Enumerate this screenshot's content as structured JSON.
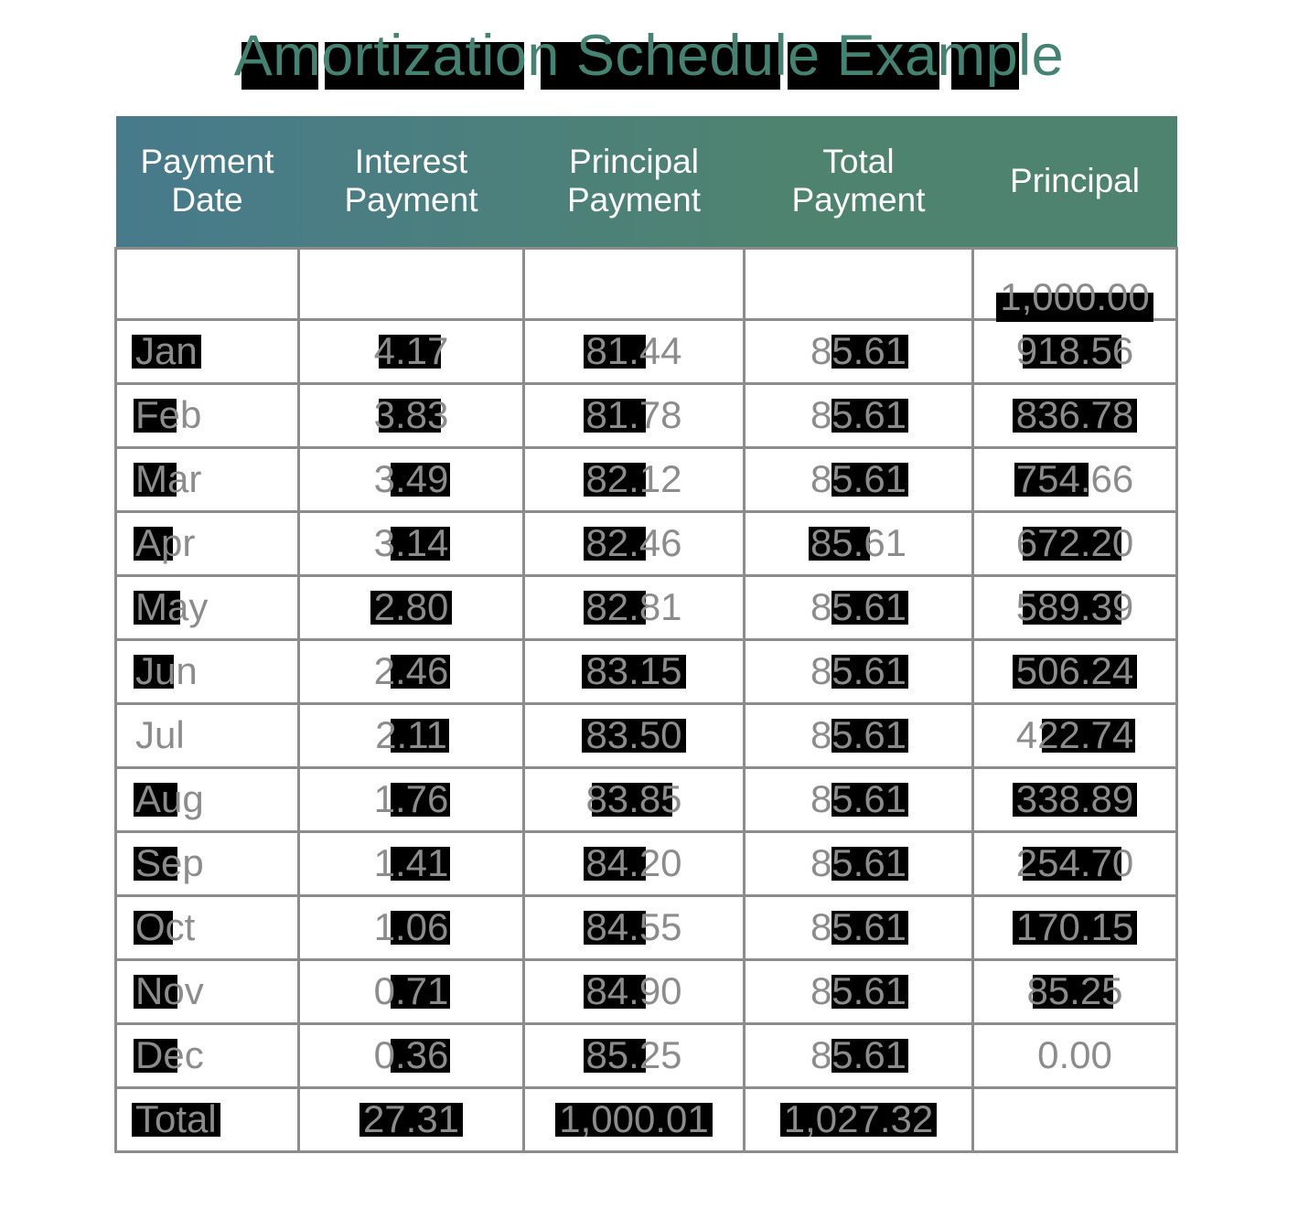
{
  "title": "Amortization Schedule Example",
  "colors": {
    "title_text": "#448272",
    "header_gradient_left": "#477A8B",
    "header_gradient_right": "#4E836F",
    "cell_text": "#8c8c8c",
    "grid_line": "#8c8c8c",
    "highlight": "#000000"
  },
  "table": {
    "headers": [
      "Payment\nDate",
      "Interest\nPayment",
      "Principal\nPayment",
      "Total\nPayment",
      "Principal"
    ],
    "headers_split": [
      {
        "line1": "Payment",
        "line2": "Date"
      },
      {
        "line1": "Interest",
        "line2": "Payment"
      },
      {
        "line1": "Principal",
        "line2": "Payment"
      },
      {
        "line1": "Total",
        "line2": "Payment"
      },
      {
        "line1": "Principal",
        "line2": ""
      }
    ],
    "rows": [
      {
        "date": "",
        "interest": "",
        "principal": "",
        "total": "",
        "balance": "1,000.00"
      },
      {
        "date": "Jan",
        "interest": "4.17",
        "principal": "81.44",
        "total": "85.61",
        "balance": "918.56"
      },
      {
        "date": "Feb",
        "interest": "3.83",
        "principal": "81.78",
        "total": "85.61",
        "balance": "836.78"
      },
      {
        "date": "Mar",
        "interest": "3.49",
        "principal": "82.12",
        "total": "85.61",
        "balance": "754.66"
      },
      {
        "date": "Apr",
        "interest": "3.14",
        "principal": "82.46",
        "total": "85.61",
        "balance": "672.20"
      },
      {
        "date": "May",
        "interest": "2.80",
        "principal": "82.81",
        "total": "85.61",
        "balance": "589.39"
      },
      {
        "date": "Jun",
        "interest": "2.46",
        "principal": "83.15",
        "total": "85.61",
        "balance": "506.24"
      },
      {
        "date": "Jul",
        "interest": "2.11",
        "principal": "83.50",
        "total": "85.61",
        "balance": "422.74"
      },
      {
        "date": "Aug",
        "interest": "1.76",
        "principal": "83.85",
        "total": "85.61",
        "balance": "338.89"
      },
      {
        "date": "Sep",
        "interest": "1.41",
        "principal": "84.20",
        "total": "85.61",
        "balance": "254.70"
      },
      {
        "date": "Oct",
        "interest": "1.06",
        "principal": "84.55",
        "total": "85.61",
        "balance": "170.15"
      },
      {
        "date": "Nov",
        "interest": "0.71",
        "principal": "84.90",
        "total": "85.61",
        "balance": "85.25"
      },
      {
        "date": "Dec",
        "interest": "0.36",
        "principal": "85.25",
        "total": "85.61",
        "balance": "0.00"
      },
      {
        "date": "Total",
        "interest": "27.31",
        "principal": "1,000.01",
        "total": "1,027.32",
        "balance": ""
      }
    ]
  }
}
